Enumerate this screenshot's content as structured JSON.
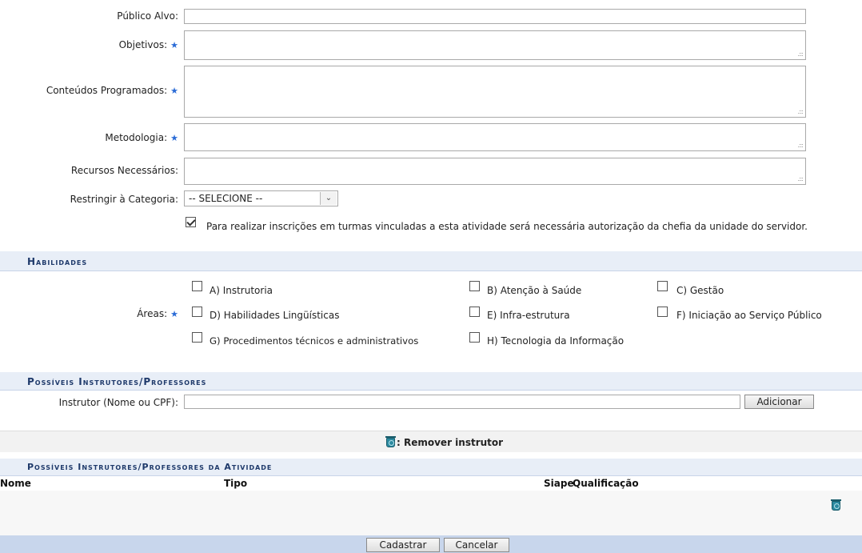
{
  "form": {
    "publico_alvo_label": "Público Alvo:",
    "objetivos_label": "Objetivos:",
    "conteudos_label": "Conteúdos Programados:",
    "metodologia_label": "Metodologia:",
    "recursos_label": "Recursos Necessários:",
    "restringir_label": "Restringir à Categoria:",
    "restringir_value": "-- SELECIONE --",
    "required_mark": "★",
    "autorizacao_text": "Para realizar inscrições em turmas vinculadas a esta atividade será necessária autorização da chefia da unidade do servidor."
  },
  "habilidades": {
    "title": "Habilidades",
    "areas_label": "Áreas:",
    "options": [
      {
        "label": "A) Instrutoria",
        "checked": false
      },
      {
        "label": "B) Atenção à Saúde",
        "checked": false
      },
      {
        "label": "C) Gestão",
        "checked": false
      },
      {
        "label": "D) Habilidades Lingüísticas",
        "checked": false
      },
      {
        "label": "E) Infra-estrutura",
        "checked": false
      },
      {
        "label": "F) Iniciação ao Serviço Público",
        "checked": false
      },
      {
        "label": "G) Procedimentos técnicos e administrativos",
        "checked": false
      },
      {
        "label": "H) Tecnologia da Informação",
        "checked": false
      }
    ]
  },
  "instrutores": {
    "title": "Possíveis Instrutores/Professores",
    "instrutor_label": "Instrutor (Nome ou CPF):",
    "adicionar_label": "Adicionar",
    "legend_text": ": Remover instrutor"
  },
  "atividade": {
    "title": "Possíveis Instrutores/Professores da Atividade",
    "columns": [
      "Nome",
      "Tipo",
      "Siape",
      "Qualificação"
    ]
  },
  "footer": {
    "cadastrar_label": "Cadastrar",
    "cancelar_label": "Cancelar"
  },
  "colors": {
    "section_bg": "#e8eef7",
    "footer_bg": "#c8d6ec",
    "required": "#2a6bd6"
  }
}
